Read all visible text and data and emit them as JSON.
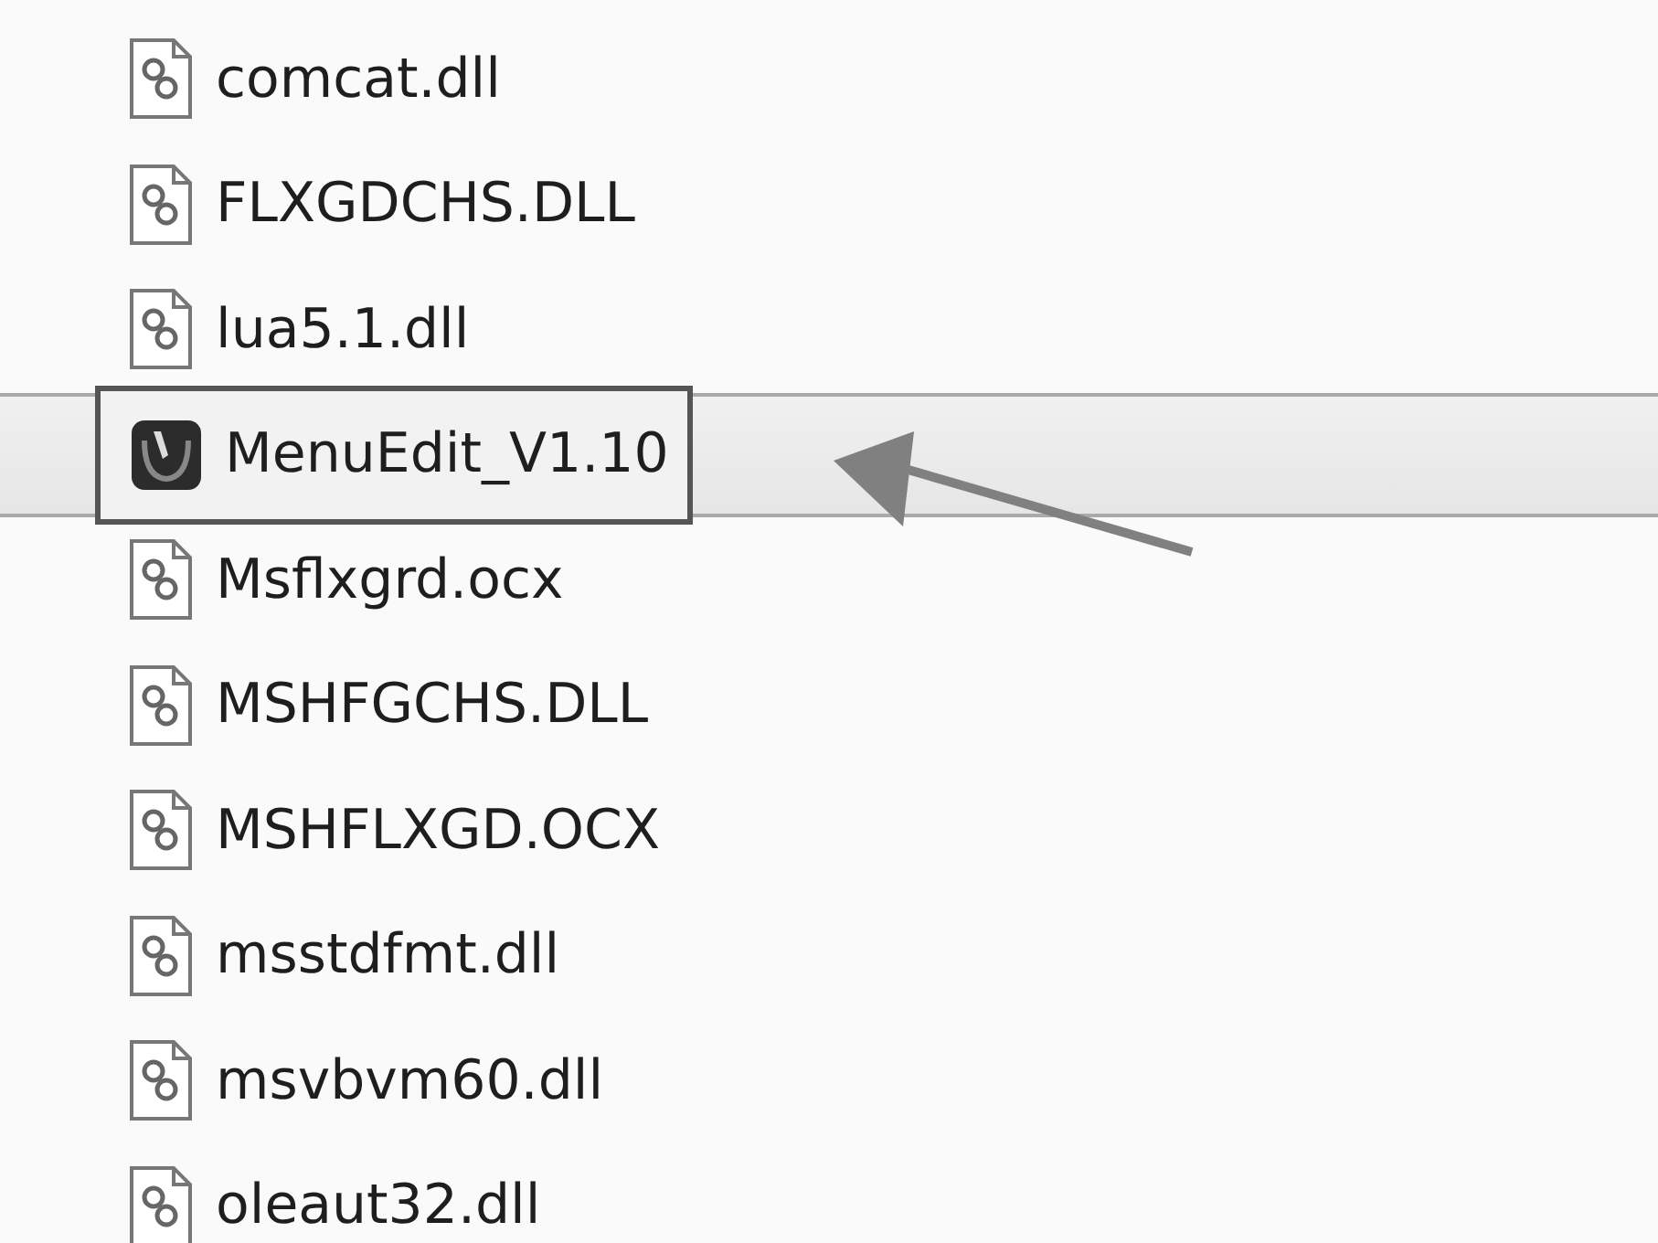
{
  "files": [
    {
      "name": "comcat.dll",
      "kind": "dll",
      "selected": false
    },
    {
      "name": "FLXGDCHS.DLL",
      "kind": "dll",
      "selected": false
    },
    {
      "name": "lua5.1.dll",
      "kind": "dll",
      "selected": false
    },
    {
      "name": "MenuEdit_V1.10",
      "kind": "app",
      "selected": true
    },
    {
      "name": "Msflxgrd.ocx",
      "kind": "dll",
      "selected": false
    },
    {
      "name": "MSHFGCHS.DLL",
      "kind": "dll",
      "selected": false
    },
    {
      "name": "MSHFLXGD.OCX",
      "kind": "dll",
      "selected": false
    },
    {
      "name": "msstdfmt.dll",
      "kind": "dll",
      "selected": false
    },
    {
      "name": "msvbvm60.dll",
      "kind": "dll",
      "selected": false
    },
    {
      "name": "oleaut32.dll",
      "kind": "dll",
      "selected": false
    }
  ]
}
